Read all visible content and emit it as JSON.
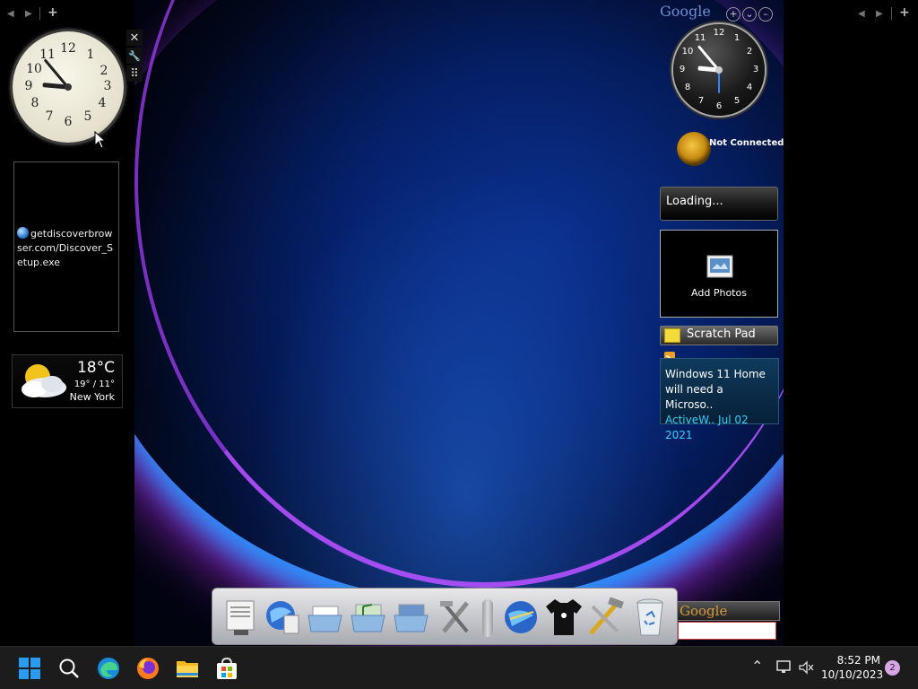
{
  "left_sidebar": {
    "nav": {
      "prev": "◀",
      "next": "▶",
      "add": "+"
    },
    "clock_numbers": [
      "12",
      "1",
      "2",
      "3",
      "4",
      "5",
      "6",
      "7",
      "8",
      "9",
      "10",
      "11"
    ],
    "download": {
      "text": "getdiscoverbrowser.com/Discover_Setup.exe"
    },
    "weather": {
      "temp": "18°C",
      "range": "19° / 11°",
      "city": "New York"
    }
  },
  "gadget_tools": {
    "close": "✕",
    "settings": "🔧",
    "drag": "⠿"
  },
  "right_sidebar": {
    "nav": {
      "prev": "◀",
      "next": "▶",
      "add": "+"
    },
    "google_header": {
      "logo": "Google",
      "add": "+",
      "options": "⌄",
      "minimize": "–"
    },
    "clock_numbers": [
      "12",
      "1",
      "2",
      "3",
      "4",
      "5",
      "6",
      "7",
      "8",
      "9",
      "10",
      "11"
    ],
    "network": {
      "status": "Not Connected"
    },
    "loading": {
      "text": "Loading..."
    },
    "photos": {
      "label": "Add Photos"
    },
    "scratch_pad": {
      "label": "Scratch Pad"
    },
    "news": {
      "line1": "Windows 11 Home",
      "line2": "will need a Microso..",
      "meta": "ActiveW.. Jul 02 2021"
    },
    "google_search": {
      "logo": "Google",
      "placeholder": ""
    }
  },
  "dock": {
    "items": [
      "system-properties",
      "internet-explorer",
      "documents-folder",
      "music-folder",
      "pictures-folder",
      "tools",
      "separator",
      "network-globe",
      "tshirt",
      "hammer-wrench",
      "recycle-bin"
    ]
  },
  "taskbar": {
    "time": "8:52 PM",
    "date": "10/10/2023",
    "notification_count": "2",
    "overflow": "⌃"
  },
  "colors": {
    "taskbar": "#1c1c1c",
    "accent_blue": "#0a6cff",
    "news_text": "#2fd3ff",
    "badge": "#d7a6e6"
  }
}
